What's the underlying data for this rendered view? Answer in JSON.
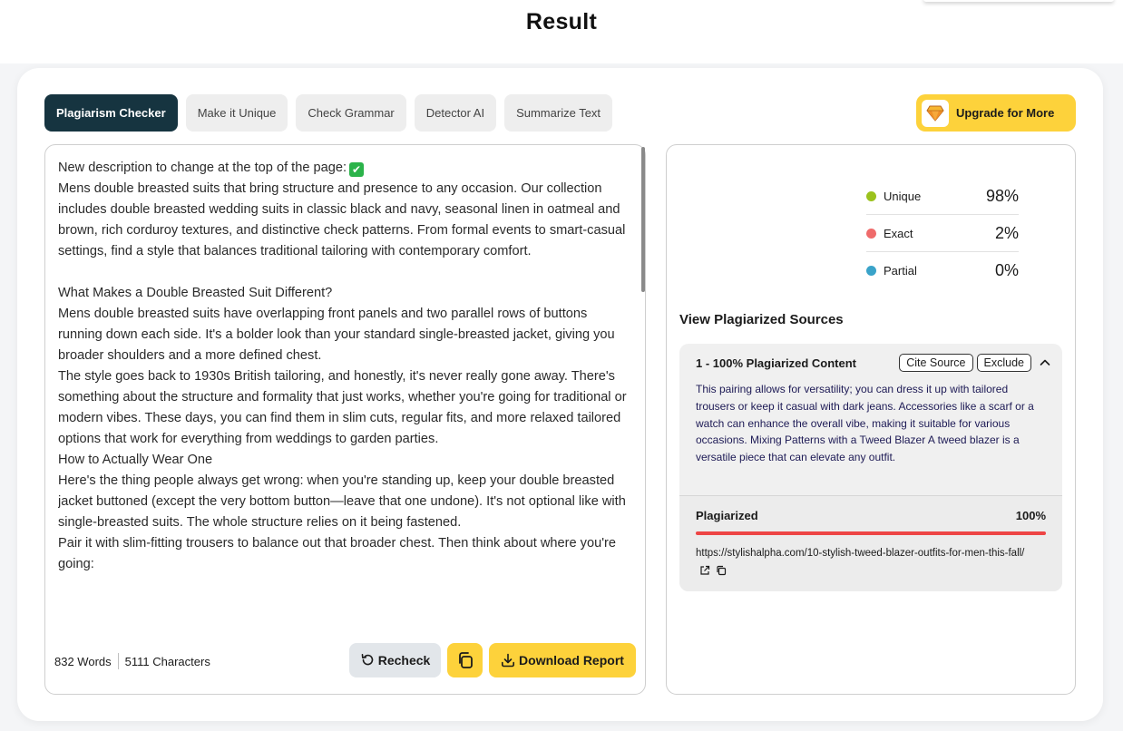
{
  "page": {
    "title": "Result"
  },
  "tabs": [
    {
      "label": "Plagiarism Checker",
      "active": true
    },
    {
      "label": "Make it Unique",
      "active": false
    },
    {
      "label": "Check Grammar",
      "active": false
    },
    {
      "label": "Detector AI",
      "active": false
    },
    {
      "label": "Summarize Text",
      "active": false
    }
  ],
  "upgrade": {
    "label": "Upgrade for More",
    "icon": "diamond-icon"
  },
  "editor": {
    "lines": [
      "New description to change at the top of the page:",
      "Mens double breasted suits that bring structure and presence to any occasion. Our collection includes double breasted wedding suits in classic black and navy, seasonal linen in oatmeal and brown, rich corduroy textures, and distinctive check patterns. From formal events to smart-casual settings, find a style that balances traditional tailoring with contemporary comfort.",
      "",
      "What Makes a Double Breasted Suit Different?",
      "Mens double breasted suits have overlapping front panels and two parallel rows of buttons running down each side. It's a bolder look than your standard single-breasted jacket, giving you broader shoulders and a more defined chest.",
      "The style goes back to 1930s British tailoring, and honestly, it's never really gone away. There's something about the structure and formality that just works, whether you're going for traditional or modern vibes. These days, you can find them in slim cuts, regular fits, and more relaxed tailored options that work for everything from weddings to garden parties.",
      "How to Actually Wear One",
      "Here's the thing people always get wrong: when you're standing up, keep your double breasted jacket buttoned (except the very bottom button—leave that one undone). It's not optional like with single-breasted suits. The whole structure relies on it being fastened.",
      "Pair it with slim-fitting trousers to balance out that broader chest. Then think about where you're going:"
    ],
    "emoji": "✔",
    "emoji_icon": "check-mark-emoji"
  },
  "counts": {
    "words": "832 Words",
    "characters": "5111 Characters"
  },
  "actions": {
    "recheck": "Recheck",
    "download": "Download Report"
  },
  "stats": [
    {
      "label": "Unique",
      "value": "98%",
      "color": "#9bc21d"
    },
    {
      "label": "Exact",
      "value": "2%",
      "color": "#ef6b6b"
    },
    {
      "label": "Partial",
      "value": "0%",
      "color": "#3aa3c9"
    }
  ],
  "sources": {
    "title": "View Plagiarized Sources",
    "items": [
      {
        "name": "1 - 100% Plagiarized Content",
        "cite_label": "Cite Source",
        "exclude_label": "Exclude",
        "text": "This pairing allows for versatility; you can dress it up with tailored trousers or keep it casual with dark jeans. Accessories like a scarf or a watch can enhance the overall vibe, making it suitable for various occasions. Mixing Patterns with a Tweed Blazer A tweed blazer is a versatile piece that can elevate any outfit.",
        "plagiarized_label": "Plagiarized",
        "plagiarized_percent": "100%",
        "plagiarized_fraction": 1.0,
        "url": "https://stylishalpha.com/10-stylish-tweed-blazer-outfits-for-men-this-fall/"
      }
    ]
  },
  "colors": {
    "active_tab": "#163440",
    "accent_yellow": "#fdd23b",
    "plagiarized_bar": "#ee4545"
  }
}
